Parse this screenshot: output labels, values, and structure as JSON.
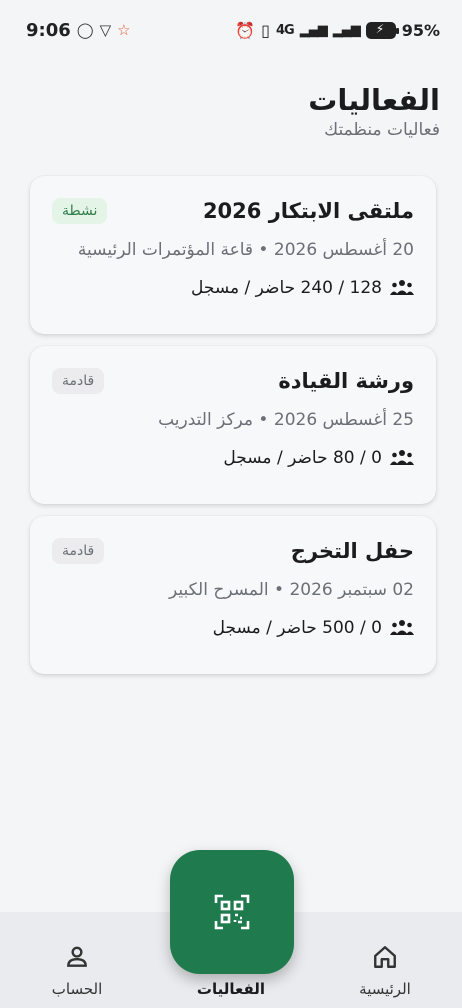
{
  "status_bar": {
    "time": "9:06",
    "battery": "95%",
    "network": "4G"
  },
  "header": {
    "title": "الفعاليات",
    "subtitle": "فعاليات منظمتك"
  },
  "events": [
    {
      "title": "ملتقى الابتكار 2026",
      "status": "نشطة",
      "meta": "20 أغسطس 2026 • قاعة المؤتمرات الرئيسية",
      "stats": "128 / 240 حاضر / مسجل"
    },
    {
      "title": "ورشة القيادة",
      "status": "قادمة",
      "meta": "25 أغسطس 2026 • مركز التدريب",
      "stats": "0 / 80 حاضر / مسجل"
    },
    {
      "title": "حفل التخرج",
      "status": "قادمة",
      "meta": "02 سبتمبر 2026 • المسرح الكبير",
      "stats": "0 / 500 حاضر / مسجل"
    }
  ],
  "bottom_nav": {
    "home_label": "الرئيسية",
    "events_label": "الفعاليات",
    "account_label": "الحساب"
  },
  "colors": {
    "accent": "#1f7a4d",
    "active_badge_bg": "#e4f4e7",
    "active_badge_text": "#2e7d4a",
    "upcoming_badge_bg": "#ececee"
  },
  "icons": {
    "fab": "qr-scan-icon",
    "home": "home-icon",
    "account": "person-icon",
    "attendees": "people-icon"
  }
}
